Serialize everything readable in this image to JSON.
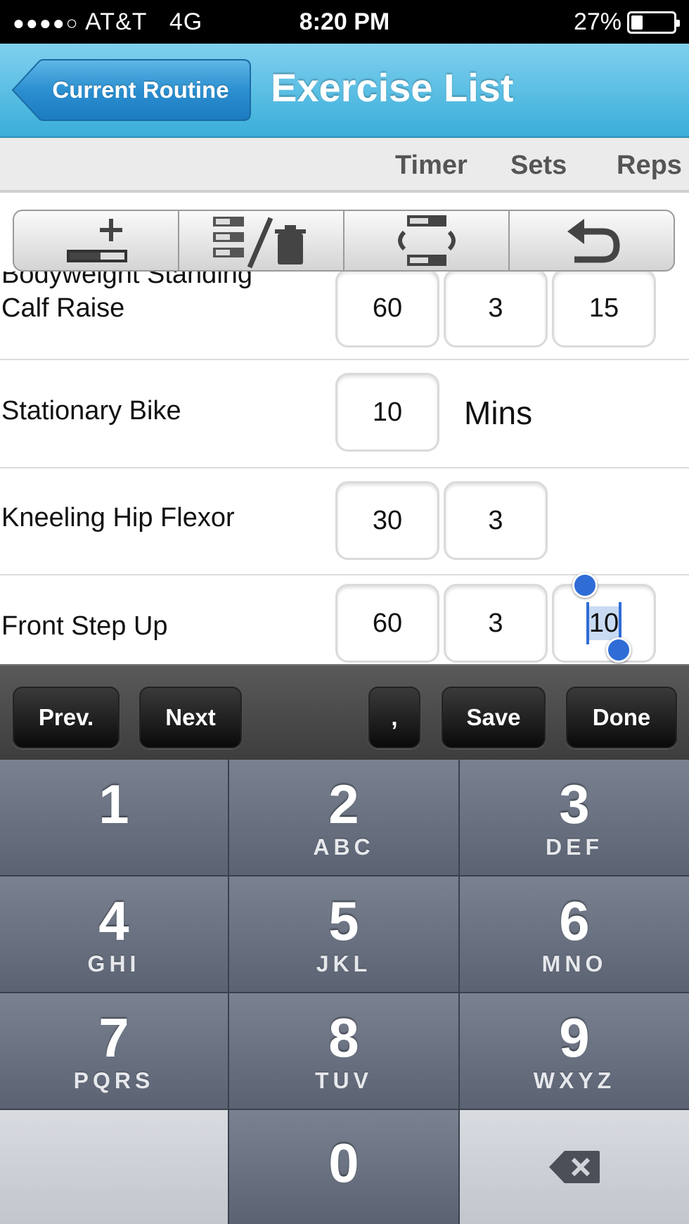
{
  "status_bar": {
    "signal_dots": "●●●●○",
    "carrier": "AT&T",
    "network": "4G",
    "time": "8:20 PM",
    "battery": "27%",
    "battery_level": 0.27
  },
  "nav": {
    "back_label": "Current Routine",
    "title": "Exercise List"
  },
  "columns": {
    "timer": "Timer",
    "sets": "Sets",
    "reps": "Reps"
  },
  "toolbar": {
    "icons": [
      "add-exercise-icon",
      "reorder-delete-icon",
      "swap-icon",
      "undo-icon"
    ]
  },
  "exercises": [
    {
      "name_line1": "Bodyweight Standing",
      "name_line2": "Calf Raise",
      "timer": "60",
      "sets": "3",
      "reps": "15"
    },
    {
      "name": "Stationary Bike",
      "timer": "10",
      "unit": "Mins"
    },
    {
      "name": "Kneeling Hip Flexor",
      "timer": "30",
      "sets": "3"
    },
    {
      "name": "Front Step Up",
      "timer": "60",
      "sets": "3",
      "reps": "10"
    }
  ],
  "accessory": {
    "prev": "Prev.",
    "next": "Next",
    "comma": ",",
    "save": "Save",
    "done": "Done"
  },
  "keypad": {
    "keys": [
      {
        "num": "1",
        "letters": ""
      },
      {
        "num": "2",
        "letters": "ABC"
      },
      {
        "num": "3",
        "letters": "DEF"
      },
      {
        "num": "4",
        "letters": "GHI"
      },
      {
        "num": "5",
        "letters": "JKL"
      },
      {
        "num": "6",
        "letters": "MNO"
      },
      {
        "num": "7",
        "letters": "PQRS"
      },
      {
        "num": "8",
        "letters": "TUV"
      },
      {
        "num": "9",
        "letters": "WXYZ"
      },
      {
        "num": "0",
        "letters": ""
      }
    ],
    "delete_icon": "backspace-icon"
  }
}
